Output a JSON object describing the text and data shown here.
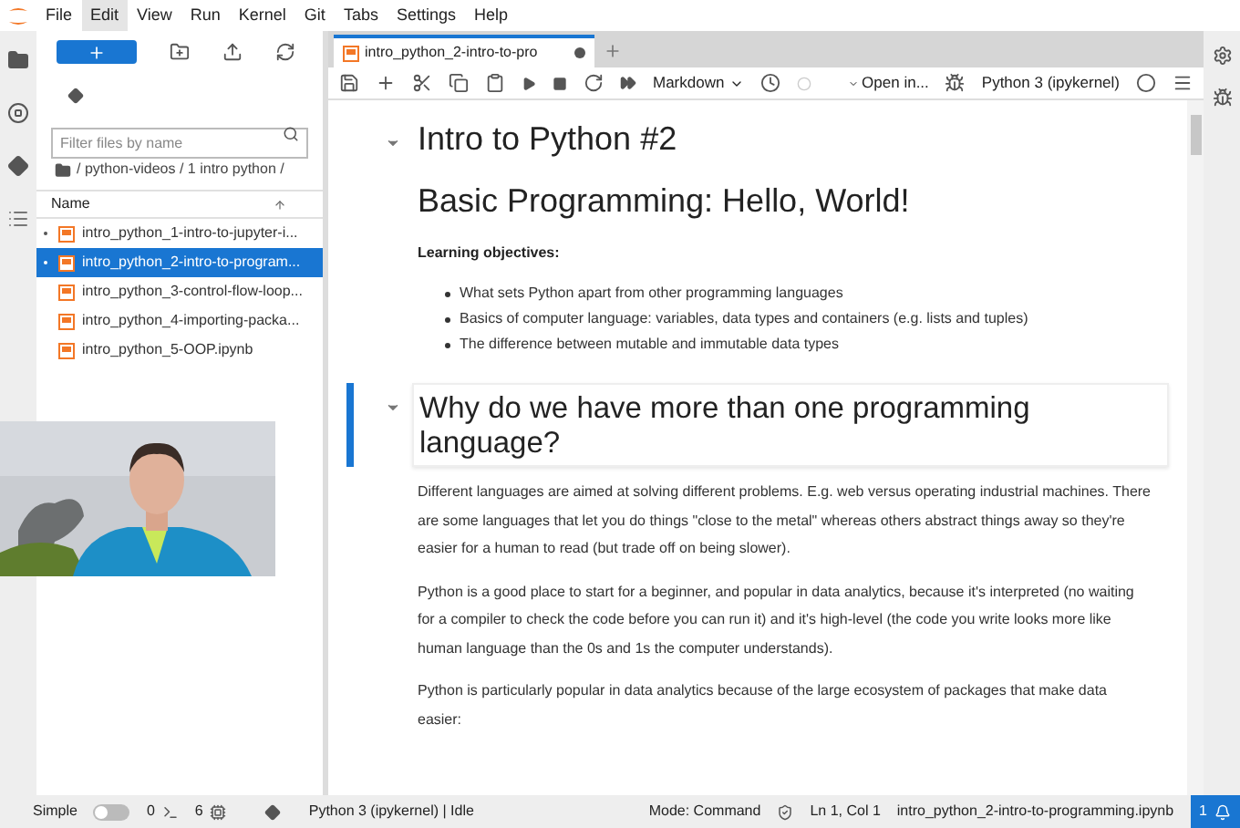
{
  "menu": [
    {
      "label": "File",
      "selected": false
    },
    {
      "label": "Edit",
      "selected": true
    },
    {
      "label": "View",
      "selected": false
    },
    {
      "label": "Run",
      "selected": false
    },
    {
      "label": "Kernel",
      "selected": false
    },
    {
      "label": "Git",
      "selected": false
    },
    {
      "label": "Tabs",
      "selected": false
    },
    {
      "label": "Settings",
      "selected": false
    },
    {
      "label": "Help",
      "selected": false
    }
  ],
  "file_browser": {
    "filter": {
      "placeholder": "Filter files by name"
    },
    "breadcrumb": "/ python-videos / 1 intro python /",
    "column": "Name",
    "files": [
      {
        "name": "intro_python_1-intro-to-jupyter-i...",
        "running": true,
        "selected": false
      },
      {
        "name": "intro_python_2-intro-to-program...",
        "running": true,
        "selected": true
      },
      {
        "name": "intro_python_3-control-flow-loop...",
        "running": false,
        "selected": false
      },
      {
        "name": "intro_python_4-importing-packa...",
        "running": false,
        "selected": false
      },
      {
        "name": "intro_python_5-OOP.ipynb",
        "running": false,
        "selected": false
      }
    ]
  },
  "notebook_tab": {
    "title": "intro_python_2-intro-to-pro",
    "unsaved": true
  },
  "toolbar": {
    "cell_type": "Markdown",
    "open_in": "Open in...",
    "kernel": "Python 3 (ipykernel)"
  },
  "cells": [
    {
      "selected": false,
      "collapsible": true,
      "blocks": [
        {
          "kind": "h1",
          "text": "Intro to Python #2"
        },
        {
          "kind": "h1",
          "text": "Basic Programming: Hello, World!"
        },
        {
          "kind": "bold",
          "text": "Learning objectives:"
        },
        {
          "kind": "bullets",
          "items": [
            "What sets Python apart from other programming languages",
            "Basics of computer language: variables, data types and containers (e.g. lists and tuples)",
            "The difference between mutable and immutable data types"
          ]
        }
      ]
    },
    {
      "selected": true,
      "collapsible": true,
      "blocks": [
        {
          "kind": "h2",
          "text": "Why do we have more than one programming language?"
        }
      ]
    },
    {
      "selected": false,
      "collapsible": false,
      "blocks": [
        {
          "kind": "p",
          "text": "Different languages are aimed at solving different problems. E.g. web versus operating industrial machines. There are some languages that let you do things \"close to the metal\" whereas others abstract things away so they're easier for a human to read (but trade off on being slower)."
        },
        {
          "kind": "p",
          "text": "Python is a good place to start for a beginner, and popular in data analytics, because it's interpreted (no waiting for a compiler to check the code before you can run it) and it's high-level (the code you write looks more like human language than the 0s and 1s the computer understands)."
        },
        {
          "kind": "p",
          "text": "Python is particularly popular in data analytics because of the large ecosystem of packages that make data easier:"
        }
      ]
    }
  ],
  "status_bar": {
    "simple_mode": {
      "label": "Simple",
      "on": false
    },
    "terminals": "0",
    "kernels": "6",
    "kernel_status": "Python 3 (ipykernel) | Idle",
    "mode": "Mode: Command",
    "position": "Ln 1, Col 1",
    "file": "intro_python_2-intro-to-programming.ipynb",
    "notifications": "1"
  }
}
